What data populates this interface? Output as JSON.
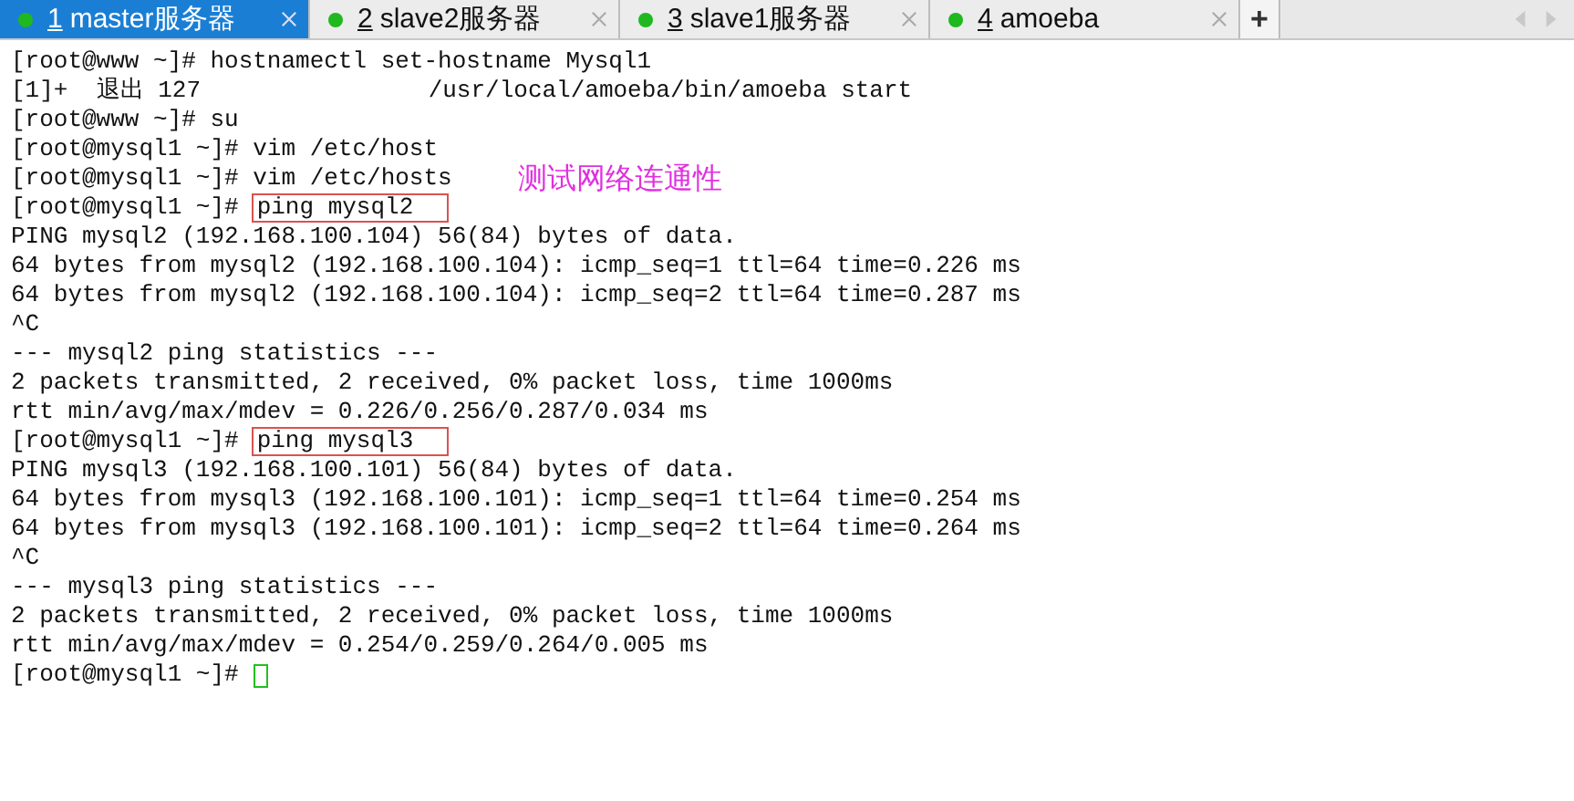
{
  "tabs": [
    {
      "number": "1",
      "label": "master服务器",
      "selected": true,
      "connected": true
    },
    {
      "number": "2",
      "label": "slave2服务器",
      "selected": false,
      "connected": true
    },
    {
      "number": "3",
      "label": "slave1服务器",
      "selected": false,
      "connected": true
    },
    {
      "number": "4",
      "label": "amoeba",
      "selected": false,
      "connected": true
    }
  ],
  "new_tab_button": "+",
  "terminal": {
    "lines": [
      {
        "kind": "text",
        "text": "[root@www ~]# hostnamectl set-hostname Mysql1"
      },
      {
        "kind": "text",
        "text": "[1]+  退出 127                /usr/local/amoeba/bin/amoeba start"
      },
      {
        "kind": "text",
        "text": "[root@www ~]# su"
      },
      {
        "kind": "text",
        "text": "[root@mysql1 ~]# vim /etc/host"
      },
      {
        "kind": "text",
        "text": "[root@mysql1 ~]# vim /etc/hosts",
        "note": "测试网络连通性"
      },
      {
        "kind": "boxed",
        "prompt": "[root@mysql1 ~]#",
        "command": "ping mysql2"
      },
      {
        "kind": "text",
        "text": "PING mysql2 (192.168.100.104) 56(84) bytes of data."
      },
      {
        "kind": "text",
        "text": "64 bytes from mysql2 (192.168.100.104): icmp_seq=1 ttl=64 time=0.226 ms"
      },
      {
        "kind": "text",
        "text": "64 bytes from mysql2 (192.168.100.104): icmp_seq=2 ttl=64 time=0.287 ms"
      },
      {
        "kind": "text",
        "text": "^C"
      },
      {
        "kind": "text",
        "text": "--- mysql2 ping statistics ---"
      },
      {
        "kind": "text",
        "text": "2 packets transmitted, 2 received, 0% packet loss, time 1000ms"
      },
      {
        "kind": "text",
        "text": "rtt min/avg/max/mdev = 0.226/0.256/0.287/0.034 ms"
      },
      {
        "kind": "boxed",
        "prompt": "[root@mysql1 ~]#",
        "command": "ping mysql3"
      },
      {
        "kind": "text",
        "text": "PING mysql3 (192.168.100.101) 56(84) bytes of data."
      },
      {
        "kind": "text",
        "text": "64 bytes from mysql3 (192.168.100.101): icmp_seq=1 ttl=64 time=0.254 ms"
      },
      {
        "kind": "text",
        "text": "64 bytes from mysql3 (192.168.100.101): icmp_seq=2 ttl=64 time=0.264 ms"
      },
      {
        "kind": "text",
        "text": "^C"
      },
      {
        "kind": "text",
        "text": "--- mysql3 ping statistics ---"
      },
      {
        "kind": "text",
        "text": "2 packets transmitted, 2 received, 0% packet loss, time 1000ms"
      },
      {
        "kind": "text",
        "text": "rtt min/avg/max/mdev = 0.254/0.259/0.264/0.005 ms"
      },
      {
        "kind": "cursor",
        "prompt": "[root@mysql1 ~]#"
      }
    ]
  }
}
